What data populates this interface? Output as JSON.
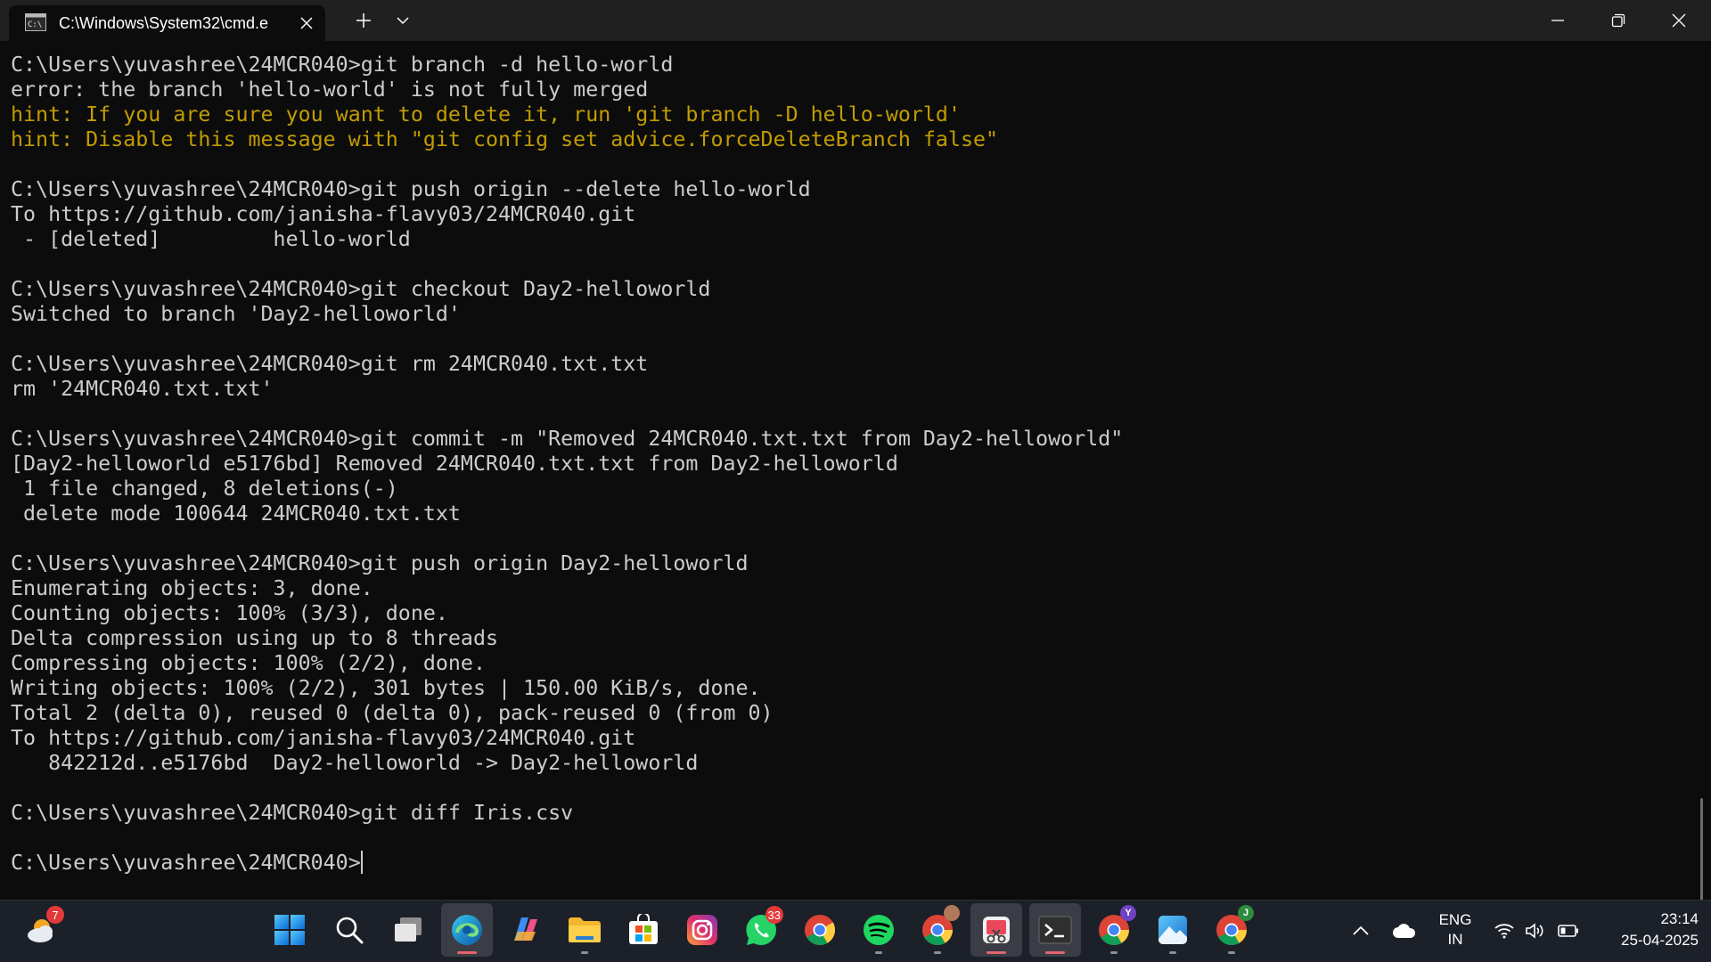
{
  "window": {
    "tab_title": "C:\\Windows\\System32\\cmd.e",
    "tab_icon": "cmd-icon",
    "controls": [
      "new-tab-icon",
      "dropdown-icon",
      "minimize-icon",
      "maximize-icon",
      "close-icon"
    ]
  },
  "terminal": {
    "lines": [
      {
        "text": "C:\\Users\\yuvashree\\24MCR040>git branch -d hello-world",
        "kind": "normal"
      },
      {
        "text": "error: the branch 'hello-world' is not fully merged",
        "kind": "normal"
      },
      {
        "text": "hint: If you are sure you want to delete it, run 'git branch -D hello-world'",
        "kind": "hint"
      },
      {
        "text": "hint: Disable this message with \"git config set advice.forceDeleteBranch false\"",
        "kind": "hint"
      },
      {
        "text": "",
        "kind": "normal"
      },
      {
        "text": "C:\\Users\\yuvashree\\24MCR040>git push origin --delete hello-world",
        "kind": "normal"
      },
      {
        "text": "To https://github.com/janisha-flavy03/24MCR040.git",
        "kind": "normal"
      },
      {
        "text": " - [deleted]         hello-world",
        "kind": "normal"
      },
      {
        "text": "",
        "kind": "normal"
      },
      {
        "text": "C:\\Users\\yuvashree\\24MCR040>git checkout Day2-helloworld",
        "kind": "normal"
      },
      {
        "text": "Switched to branch 'Day2-helloworld'",
        "kind": "normal"
      },
      {
        "text": "",
        "kind": "normal"
      },
      {
        "text": "C:\\Users\\yuvashree\\24MCR040>git rm 24MCR040.txt.txt",
        "kind": "normal"
      },
      {
        "text": "rm '24MCR040.txt.txt'",
        "kind": "normal"
      },
      {
        "text": "",
        "kind": "normal"
      },
      {
        "text": "C:\\Users\\yuvashree\\24MCR040>git commit -m \"Removed 24MCR040.txt.txt from Day2-helloworld\"",
        "kind": "normal"
      },
      {
        "text": "[Day2-helloworld e5176bd] Removed 24MCR040.txt.txt from Day2-helloworld",
        "kind": "normal"
      },
      {
        "text": " 1 file changed, 8 deletions(-)",
        "kind": "normal"
      },
      {
        "text": " delete mode 100644 24MCR040.txt.txt",
        "kind": "normal"
      },
      {
        "text": "",
        "kind": "normal"
      },
      {
        "text": "C:\\Users\\yuvashree\\24MCR040>git push origin Day2-helloworld",
        "kind": "normal"
      },
      {
        "text": "Enumerating objects: 3, done.",
        "kind": "normal"
      },
      {
        "text": "Counting objects: 100% (3/3), done.",
        "kind": "normal"
      },
      {
        "text": "Delta compression using up to 8 threads",
        "kind": "normal"
      },
      {
        "text": "Compressing objects: 100% (2/2), done.",
        "kind": "normal"
      },
      {
        "text": "Writing objects: 100% (2/2), 301 bytes | 150.00 KiB/s, done.",
        "kind": "normal"
      },
      {
        "text": "Total 2 (delta 0), reused 0 (delta 0), pack-reused 0 (from 0)",
        "kind": "normal"
      },
      {
        "text": "To https://github.com/janisha-flavy03/24MCR040.git",
        "kind": "normal"
      },
      {
        "text": "   842212d..e5176bd  Day2-helloworld -> Day2-helloworld",
        "kind": "normal"
      },
      {
        "text": "",
        "kind": "normal"
      },
      {
        "text": "C:\\Users\\yuvashree\\24MCR040>git diff Iris.csv",
        "kind": "normal"
      },
      {
        "text": "",
        "kind": "normal"
      }
    ],
    "prompt": "C:\\Users\\yuvashree\\24MCR040>"
  },
  "taskbar": {
    "weather_badge": "7",
    "apps": [
      {
        "name": "start",
        "icon": "windows-start-icon"
      },
      {
        "name": "search",
        "icon": "search-icon"
      },
      {
        "name": "task-view",
        "icon": "task-view-icon"
      },
      {
        "name": "edge",
        "icon": "edge-icon"
      },
      {
        "name": "copilot",
        "icon": "copilot-icon"
      },
      {
        "name": "file-explorer",
        "icon": "folder-icon"
      },
      {
        "name": "microsoft-store",
        "icon": "store-icon"
      },
      {
        "name": "instagram",
        "icon": "instagram-icon"
      },
      {
        "name": "whatsapp",
        "icon": "whatsapp-icon",
        "badge": "33"
      },
      {
        "name": "chrome",
        "icon": "chrome-icon"
      },
      {
        "name": "spotify",
        "icon": "spotify-icon"
      },
      {
        "name": "chrome-profile-photo",
        "icon": "chrome-icon"
      },
      {
        "name": "snipping-tool",
        "icon": "snipping-tool-icon"
      },
      {
        "name": "terminal",
        "icon": "terminal-icon"
      },
      {
        "name": "chrome-profile-y",
        "icon": "chrome-icon",
        "avatar": "Y"
      },
      {
        "name": "photos",
        "icon": "photos-icon"
      },
      {
        "name": "chrome-profile-j",
        "icon": "chrome-icon",
        "avatar": "J"
      }
    ],
    "tray": {
      "lang_line1": "ENG",
      "lang_line2": "IN",
      "time": "23:14",
      "date": "25-04-2025"
    }
  },
  "colors": {
    "terminal_bg": "#0c0c0c",
    "terminal_fg": "#cccccc",
    "hint_fg": "#c19c00",
    "titlebar_bg": "#202020",
    "taskbar_bg": "#1c2028"
  }
}
